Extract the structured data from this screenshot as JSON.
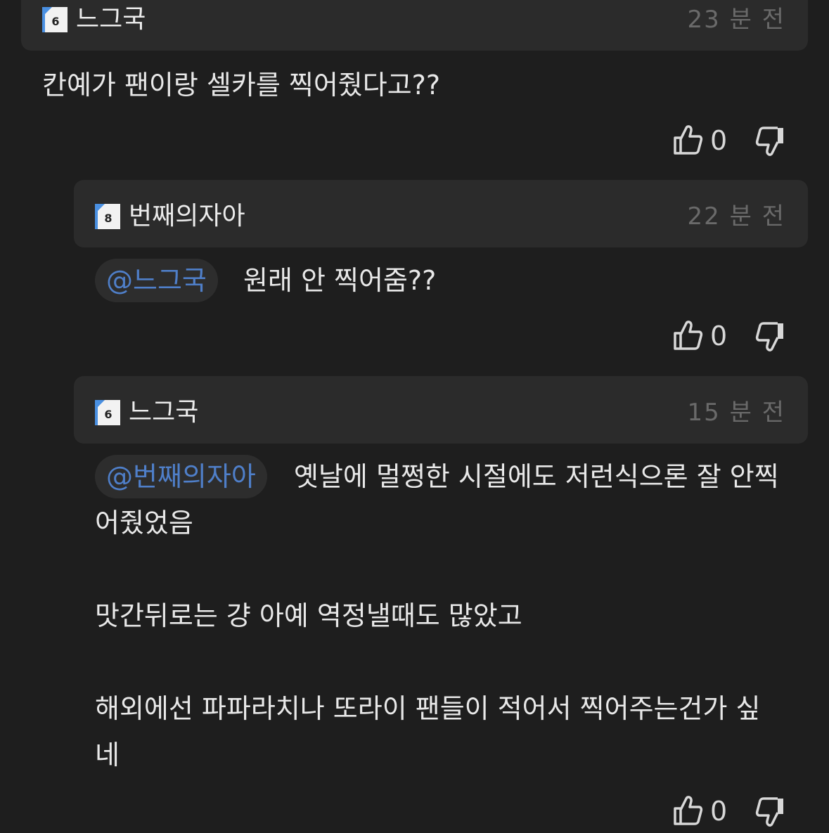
{
  "comments": [
    {
      "nickname": "느그국",
      "level_badge": "6",
      "time": "23 분 전",
      "mention": "",
      "lines": [
        "칸예가 팬이랑 셀카를 찍어줬다고??"
      ],
      "likes": "0"
    },
    {
      "nickname": "번째의자아",
      "level_badge": "8",
      "time": "22 분 전",
      "mention": "@느그국",
      "lines": [
        "원래 안 찍어줌??"
      ],
      "likes": "0"
    },
    {
      "nickname": "느그국",
      "level_badge": "6",
      "time": "15 분 전",
      "mention": "@번째의자아",
      "lines": [
        "옛날에 멀쩡한 시절에도 저런식으론 잘 안찍",
        "어줬었음",
        "맛간뒤로는 걍 아예 역정낼때도 많았고",
        "해외에선 파파라치나 또라이 팬들이 적어서 찍어주는건가 싶",
        "네"
      ],
      "likes": "0"
    }
  ],
  "icons": {
    "like": "thumbs-up-icon",
    "dislike": "thumbs-down-icon",
    "level": "level-badge-icon"
  },
  "colors": {
    "background": "#1e1e1e",
    "header": "#2b2b2b",
    "mention": "#4f7fc9",
    "time": "#6a6a6a"
  }
}
